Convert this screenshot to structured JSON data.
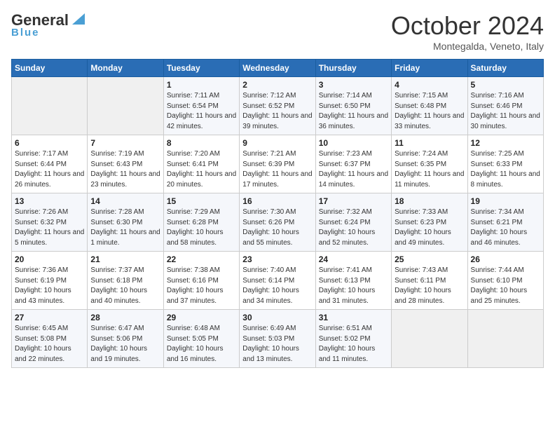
{
  "header": {
    "logo_general": "General",
    "logo_blue": "Blue",
    "month_title": "October 2024",
    "location": "Montegalda, Veneto, Italy"
  },
  "days_of_week": [
    "Sunday",
    "Monday",
    "Tuesday",
    "Wednesday",
    "Thursday",
    "Friday",
    "Saturday"
  ],
  "weeks": [
    [
      {
        "day": "",
        "info": ""
      },
      {
        "day": "",
        "info": ""
      },
      {
        "day": "1",
        "info": "Sunrise: 7:11 AM\nSunset: 6:54 PM\nDaylight: 11 hours and 42 minutes."
      },
      {
        "day": "2",
        "info": "Sunrise: 7:12 AM\nSunset: 6:52 PM\nDaylight: 11 hours and 39 minutes."
      },
      {
        "day": "3",
        "info": "Sunrise: 7:14 AM\nSunset: 6:50 PM\nDaylight: 11 hours and 36 minutes."
      },
      {
        "day": "4",
        "info": "Sunrise: 7:15 AM\nSunset: 6:48 PM\nDaylight: 11 hours and 33 minutes."
      },
      {
        "day": "5",
        "info": "Sunrise: 7:16 AM\nSunset: 6:46 PM\nDaylight: 11 hours and 30 minutes."
      }
    ],
    [
      {
        "day": "6",
        "info": "Sunrise: 7:17 AM\nSunset: 6:44 PM\nDaylight: 11 hours and 26 minutes."
      },
      {
        "day": "7",
        "info": "Sunrise: 7:19 AM\nSunset: 6:43 PM\nDaylight: 11 hours and 23 minutes."
      },
      {
        "day": "8",
        "info": "Sunrise: 7:20 AM\nSunset: 6:41 PM\nDaylight: 11 hours and 20 minutes."
      },
      {
        "day": "9",
        "info": "Sunrise: 7:21 AM\nSunset: 6:39 PM\nDaylight: 11 hours and 17 minutes."
      },
      {
        "day": "10",
        "info": "Sunrise: 7:23 AM\nSunset: 6:37 PM\nDaylight: 11 hours and 14 minutes."
      },
      {
        "day": "11",
        "info": "Sunrise: 7:24 AM\nSunset: 6:35 PM\nDaylight: 11 hours and 11 minutes."
      },
      {
        "day": "12",
        "info": "Sunrise: 7:25 AM\nSunset: 6:33 PM\nDaylight: 11 hours and 8 minutes."
      }
    ],
    [
      {
        "day": "13",
        "info": "Sunrise: 7:26 AM\nSunset: 6:32 PM\nDaylight: 11 hours and 5 minutes."
      },
      {
        "day": "14",
        "info": "Sunrise: 7:28 AM\nSunset: 6:30 PM\nDaylight: 11 hours and 1 minute."
      },
      {
        "day": "15",
        "info": "Sunrise: 7:29 AM\nSunset: 6:28 PM\nDaylight: 10 hours and 58 minutes."
      },
      {
        "day": "16",
        "info": "Sunrise: 7:30 AM\nSunset: 6:26 PM\nDaylight: 10 hours and 55 minutes."
      },
      {
        "day": "17",
        "info": "Sunrise: 7:32 AM\nSunset: 6:24 PM\nDaylight: 10 hours and 52 minutes."
      },
      {
        "day": "18",
        "info": "Sunrise: 7:33 AM\nSunset: 6:23 PM\nDaylight: 10 hours and 49 minutes."
      },
      {
        "day": "19",
        "info": "Sunrise: 7:34 AM\nSunset: 6:21 PM\nDaylight: 10 hours and 46 minutes."
      }
    ],
    [
      {
        "day": "20",
        "info": "Sunrise: 7:36 AM\nSunset: 6:19 PM\nDaylight: 10 hours and 43 minutes."
      },
      {
        "day": "21",
        "info": "Sunrise: 7:37 AM\nSunset: 6:18 PM\nDaylight: 10 hours and 40 minutes."
      },
      {
        "day": "22",
        "info": "Sunrise: 7:38 AM\nSunset: 6:16 PM\nDaylight: 10 hours and 37 minutes."
      },
      {
        "day": "23",
        "info": "Sunrise: 7:40 AM\nSunset: 6:14 PM\nDaylight: 10 hours and 34 minutes."
      },
      {
        "day": "24",
        "info": "Sunrise: 7:41 AM\nSunset: 6:13 PM\nDaylight: 10 hours and 31 minutes."
      },
      {
        "day": "25",
        "info": "Sunrise: 7:43 AM\nSunset: 6:11 PM\nDaylight: 10 hours and 28 minutes."
      },
      {
        "day": "26",
        "info": "Sunrise: 7:44 AM\nSunset: 6:10 PM\nDaylight: 10 hours and 25 minutes."
      }
    ],
    [
      {
        "day": "27",
        "info": "Sunrise: 6:45 AM\nSunset: 5:08 PM\nDaylight: 10 hours and 22 minutes."
      },
      {
        "day": "28",
        "info": "Sunrise: 6:47 AM\nSunset: 5:06 PM\nDaylight: 10 hours and 19 minutes."
      },
      {
        "day": "29",
        "info": "Sunrise: 6:48 AM\nSunset: 5:05 PM\nDaylight: 10 hours and 16 minutes."
      },
      {
        "day": "30",
        "info": "Sunrise: 6:49 AM\nSunset: 5:03 PM\nDaylight: 10 hours and 13 minutes."
      },
      {
        "day": "31",
        "info": "Sunrise: 6:51 AM\nSunset: 5:02 PM\nDaylight: 10 hours and 11 minutes."
      },
      {
        "day": "",
        "info": ""
      },
      {
        "day": "",
        "info": ""
      }
    ]
  ]
}
